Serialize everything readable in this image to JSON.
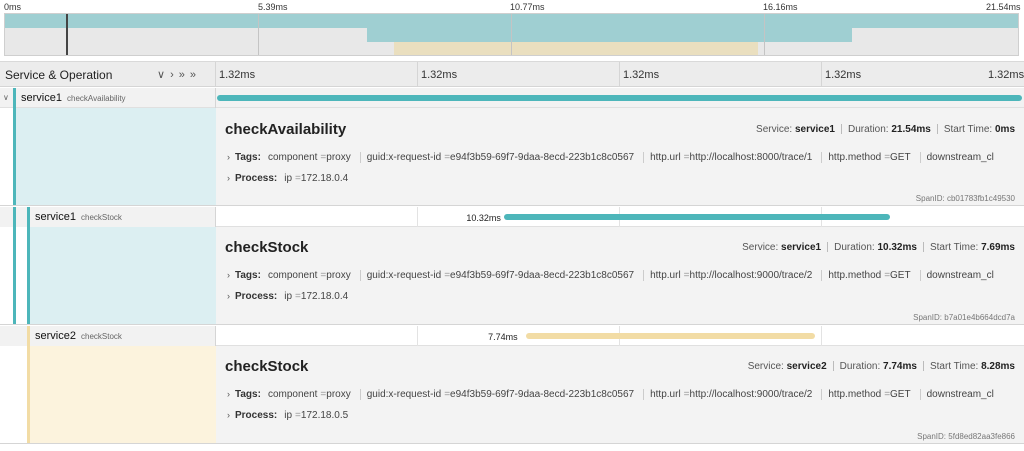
{
  "minimap": {
    "ticks": [
      "0ms",
      "5.39ms",
      "10.77ms",
      "16.16ms",
      "21.54ms"
    ]
  },
  "header": {
    "title": "Service & Operation",
    "collapse_icons": [
      "chevron-down-icon",
      "chevron-right-icon",
      "double-chevron-down-icon",
      "double-chevron-right-icon"
    ],
    "ticks": [
      "1.32ms",
      "1.32ms",
      "1.32ms",
      "1.32ms",
      "1.32ms"
    ]
  },
  "spans": [
    {
      "service": "service1",
      "operation": "checkAvailability",
      "duration_label": "",
      "start_fraction": 0.0,
      "duration_fraction": 1.0,
      "color": "#4db6ba",
      "detail": {
        "title": "checkAvailability",
        "service_label": "Service:",
        "service": "service1",
        "duration_label": "Duration:",
        "duration": "21.54ms",
        "start_label": "Start Time:",
        "start": "0ms",
        "tags_label": "Tags:",
        "tags": [
          {
            "key": "component",
            "value": "proxy"
          },
          {
            "key": "guid:x-request-id",
            "value": "e94f3b59-69f7-9daa-8ecd-223b1c8c0567"
          },
          {
            "key": "http.url",
            "value": "http://localhost:8000/trace/1"
          },
          {
            "key": "http.method",
            "value": "GET"
          },
          {
            "key": "downstream_cl",
            "value": ""
          }
        ],
        "process_label": "Process:",
        "process": [
          {
            "key": "ip",
            "value": "172.18.0.4"
          }
        ],
        "spanid_label": "SpanID:",
        "spanid": "cb01783fb1c49530"
      }
    },
    {
      "service": "service1",
      "operation": "checkStock",
      "duration_label": "10.32ms",
      "start_fraction": 0.357,
      "duration_fraction": 0.479,
      "color": "#4db6ba",
      "detail": {
        "title": "checkStock",
        "service_label": "Service:",
        "service": "service1",
        "duration_label": "Duration:",
        "duration": "10.32ms",
        "start_label": "Start Time:",
        "start": "7.69ms",
        "tags_label": "Tags:",
        "tags": [
          {
            "key": "component",
            "value": "proxy"
          },
          {
            "key": "guid:x-request-id",
            "value": "e94f3b59-69f7-9daa-8ecd-223b1c8c0567"
          },
          {
            "key": "http.url",
            "value": "http://localhost:9000/trace/2"
          },
          {
            "key": "http.method",
            "value": "GET"
          },
          {
            "key": "downstream_cl",
            "value": ""
          }
        ],
        "process_label": "Process:",
        "process": [
          {
            "key": "ip",
            "value": "172.18.0.4"
          }
        ],
        "spanid_label": "SpanID:",
        "spanid": "b7a01e4b664dcd7a"
      }
    },
    {
      "service": "service2",
      "operation": "checkStock",
      "duration_label": "7.74ms",
      "start_fraction": 0.384,
      "duration_fraction": 0.359,
      "color": "#f2dca5",
      "detail": {
        "title": "checkStock",
        "service_label": "Service:",
        "service": "service2",
        "duration_label": "Duration:",
        "duration": "7.74ms",
        "start_label": "Start Time:",
        "start": "8.28ms",
        "tags_label": "Tags:",
        "tags": [
          {
            "key": "component",
            "value": "proxy"
          },
          {
            "key": "guid:x-request-id",
            "value": "e94f3b59-69f7-9daa-8ecd-223b1c8c0567"
          },
          {
            "key": "http.url",
            "value": "http://localhost:9000/trace/2"
          },
          {
            "key": "http.method",
            "value": "GET"
          },
          {
            "key": "downstream_cl",
            "value": ""
          }
        ],
        "process_label": "Process:",
        "process": [
          {
            "key": "ip",
            "value": "172.18.0.5"
          }
        ],
        "spanid_label": "SpanID:",
        "spanid": "5fd8ed82aa3fe866"
      }
    }
  ],
  "colors": {
    "service1": "#4db6ba",
    "service1_light": "#dceff2",
    "service2": "#f2dca5",
    "service2_light": "#fcf3dd",
    "minimap_service1": "#9fcfd2",
    "minimap_service2": "#eadfbf"
  }
}
